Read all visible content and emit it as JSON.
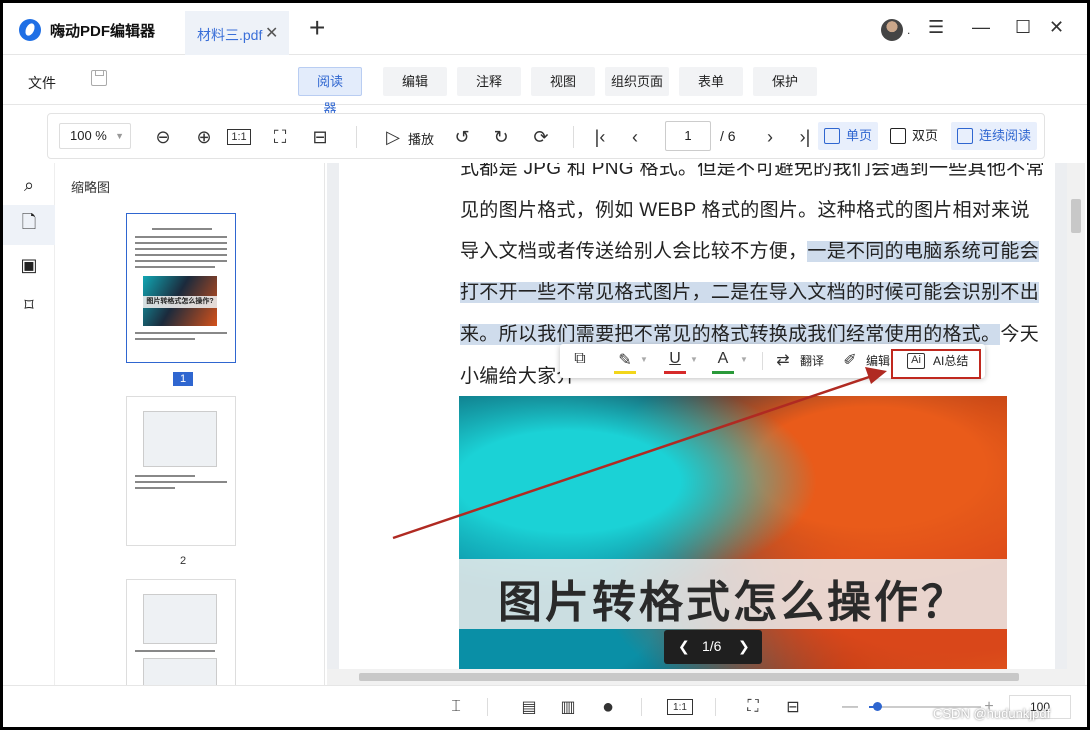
{
  "app": {
    "title": "嗨动PDF编辑器",
    "tab_label": "材料三.pdf",
    "tab_close": "✕",
    "new_tab": "+",
    "avatar_suffix": ".",
    "window_controls": {
      "menu": "☰",
      "minimize": "—",
      "maximize": "☐",
      "close": "✕"
    }
  },
  "menubar": {
    "file": "文件",
    "tabs": [
      "阅读器",
      "编辑",
      "注释",
      "视图",
      "组织页面",
      "表单",
      "保护"
    ],
    "active_tab": "阅读器"
  },
  "toolbar": {
    "zoom": "100  %",
    "play_label": "播放",
    "page_current": "1",
    "page_total": "/ 6",
    "ratio_label": "1:1",
    "view_single": "单页",
    "view_double": "双页",
    "view_continuous": "连续阅读"
  },
  "sidebar": {
    "thumbnails_title": "缩略图",
    "thumb_banner_text": "图片转格式怎么操作?",
    "thumb_labels": [
      "1",
      "2"
    ]
  },
  "document": {
    "lines": [
      {
        "plain": "式都是 JPG 和 PNG 格式。但是不可避免的我们会遇到一些其他不常",
        "highlight": ""
      },
      {
        "plain": "见的图片格式，例如 WEBP 格式的图片。这种格式的图片相对来说",
        "highlight": ""
      },
      {
        "plain": "导入文档或者传送给别人会比较不方便，",
        "highlight": "一是不同的电脑系统可能会"
      },
      {
        "plain": "",
        "highlight": "打不开一些不常见格式图片，二是在导入文档的时候可能会识别不出"
      },
      {
        "plain": "",
        "highlight": "来。所以我们需要把不常见的格式转换成我们经常使用的格式。",
        "tail": "今天"
      },
      {
        "plain": "小编给大家介",
        "highlight": ""
      }
    ],
    "image_title": "图片转格式怎么操作？",
    "image_pager": "1/6"
  },
  "floating_toolbar": {
    "translate": "翻译",
    "edit": "编辑",
    "ai_summary": "AI总结",
    "ai_icon_text": "Ai",
    "colors": {
      "highlight": "#f2d61b",
      "underline": "#d62a2a",
      "text": "#2a9a3a"
    }
  },
  "bottombar": {
    "ratio_label": "1:1",
    "zoom_minus": "—",
    "zoom_plus": "+",
    "zoom_value": "100",
    "zoom_level_fraction": 0.07
  },
  "watermark": "CSDN @hudunkjpdf",
  "colors": {
    "accent": "#2f66d0",
    "callout_red": "#c0281e"
  }
}
